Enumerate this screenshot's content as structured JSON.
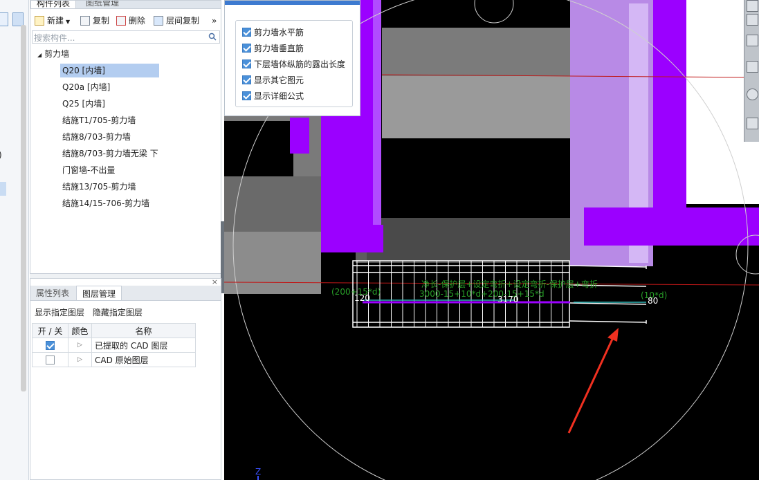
{
  "component_panel": {
    "tabs": [
      "构件列表",
      "图纸管理"
    ],
    "toolbar": {
      "new": "新建",
      "copy": "复制",
      "delete": "删除",
      "floor_copy": "层间复制",
      "more": "»"
    },
    "search_placeholder": "搜索构件...",
    "tree_root": "剪力墙",
    "tree_items": [
      "Q20 [内墙]",
      "Q20a [内墙]",
      "Q25 [内墙]",
      "结施T1/705-剪力墙",
      "结施8/703-剪力墙",
      "结施8/703-剪力墙无梁 下",
      "门窗墙-不出量",
      "结施13/705-剪力墙",
      "结施14/15-706-剪力墙"
    ]
  },
  "layer_panel": {
    "tabs": [
      "属性列表",
      "图层管理"
    ],
    "close": "×",
    "show_label": "显示指定图层",
    "hide_label": "隐藏指定图层",
    "headers": [
      "开 / 关",
      "颜色",
      "名称"
    ],
    "rows": [
      {
        "on": true,
        "name": "已提取的 CAD 图层"
      },
      {
        "on": false,
        "name": "CAD 原始图层"
      }
    ]
  },
  "options_popup": {
    "items": [
      {
        "label": "剪力墙水平筋",
        "checked": true
      },
      {
        "label": "剪力墙垂直筋",
        "checked": true
      },
      {
        "label": "下层墙体纵筋的露出长度",
        "checked": true
      },
      {
        "label": "显示其它图元",
        "checked": true
      },
      {
        "label": "显示详细公式",
        "checked": true
      }
    ]
  },
  "viewport": {
    "left_formula": "(200+15*d)",
    "top_formula": "净长-保护层+设定弯折+设定弯折-保护层+弯折",
    "main_formula": "3000-15+10*d+200-15+15*d",
    "right_formula": "(10*d)",
    "dim_left": "120",
    "dim_mid": "3170",
    "dim_right": "80",
    "axis_label": "Z",
    "colors": {
      "purple": "#9b00ff",
      "lavender": "#c79ff2",
      "annotation_green": "#28a028",
      "red_line": "#c01818",
      "arrow": "#f03020"
    }
  },
  "left_strip": {
    "fragment": ")"
  }
}
